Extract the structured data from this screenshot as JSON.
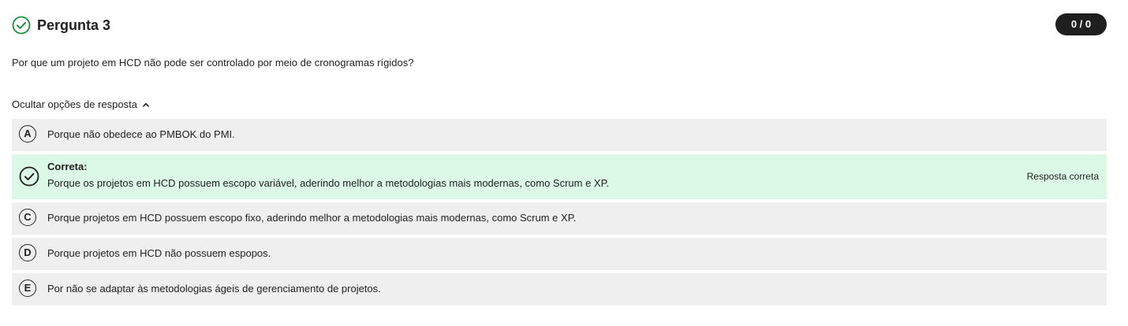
{
  "question": {
    "title": "Pergunta 3",
    "score": "0 / 0",
    "text": "Por que um projeto em HCD não pode ser controlado por meio de cronogramas rígidos?",
    "toggle_label": "Ocultar opções de resposta",
    "status_icon": "check-circle-icon",
    "status_color": "#1e8c3a"
  },
  "options": [
    {
      "letter": "A",
      "text": "Porque não obedece ao PMBOK do PMI."
    },
    {
      "letter": "B",
      "label": "Correta:",
      "text": "Porque os projetos em HCD possuem escopo variável, aderindo melhor a metodologias mais modernas, como Scrum e XP.",
      "tag": "Resposta correta"
    },
    {
      "letter": "C",
      "text": "Porque projetos em HCD possuem escopo fixo, aderindo melhor a metodologias mais modernas, como Scrum e XP."
    },
    {
      "letter": "D",
      "text": "Porque projetos em HCD não possuem espopos."
    },
    {
      "letter": "E",
      "text": "Por não se adaptar às metodologias ágeis de gerenciamento de projetos."
    }
  ],
  "colors": {
    "correct_background": "#dcf8e6",
    "option_background": "#efefef",
    "badge_background": "#1f1f1f"
  }
}
